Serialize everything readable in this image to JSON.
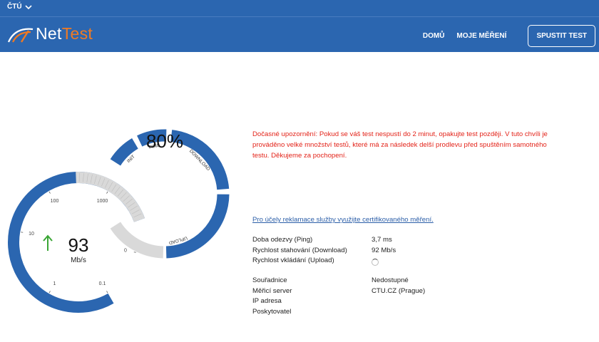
{
  "top": {
    "org_label": "ČTÚ"
  },
  "brand": {
    "net": "Net",
    "test": "Test"
  },
  "nav": {
    "home": "DOMŮ",
    "my_measurements": "MOJE MĚŘENÍ",
    "start_test": "SPUSTIT TEST"
  },
  "progress_gauge": {
    "percent_text": "80%",
    "progress": 0.8,
    "phases": [
      "INIT",
      "PING",
      "DOWNLOAD",
      "UPLOAD"
    ],
    "color_done": "#2b66b0",
    "color_pending": "#d9d9d9"
  },
  "speed_gauge": {
    "value": "93",
    "unit": "Mb/s",
    "direction_icon": "arrow-up-icon",
    "ticks": [
      "0",
      "0.1",
      "1",
      "10",
      "100",
      "1000"
    ],
    "arrow_color": "#3aa635"
  },
  "notice": {
    "warning": "Dočasné upozornění: Pokud se váš test nespustí do 2 minut, opakujte test později. V tuto chvíli je prováděno velké množství testů, které má za následek delší prodlevu před spuštěním samotného testu. Děkujeme za pochopení.",
    "warning_color": "#e32319",
    "claim_link": "Pro účely reklamace služby využijte certifikovaného měření."
  },
  "results": [
    {
      "label": "Doba odezvy (Ping)",
      "value": "3,7 ms"
    },
    {
      "label": "Rychlost stahování (Download)",
      "value": "92 Mb/s"
    },
    {
      "label": "Rychlost vkládání (Upload)",
      "value": "",
      "loading": true
    }
  ],
  "info": [
    {
      "label": "Souřadnice",
      "value": "Nedostupné"
    },
    {
      "label": "Měřicí server",
      "value": "CTU.CZ (Prague)"
    },
    {
      "label": "IP adresa",
      "value": ""
    },
    {
      "label": "Poskytovatel",
      "value": ""
    }
  ]
}
